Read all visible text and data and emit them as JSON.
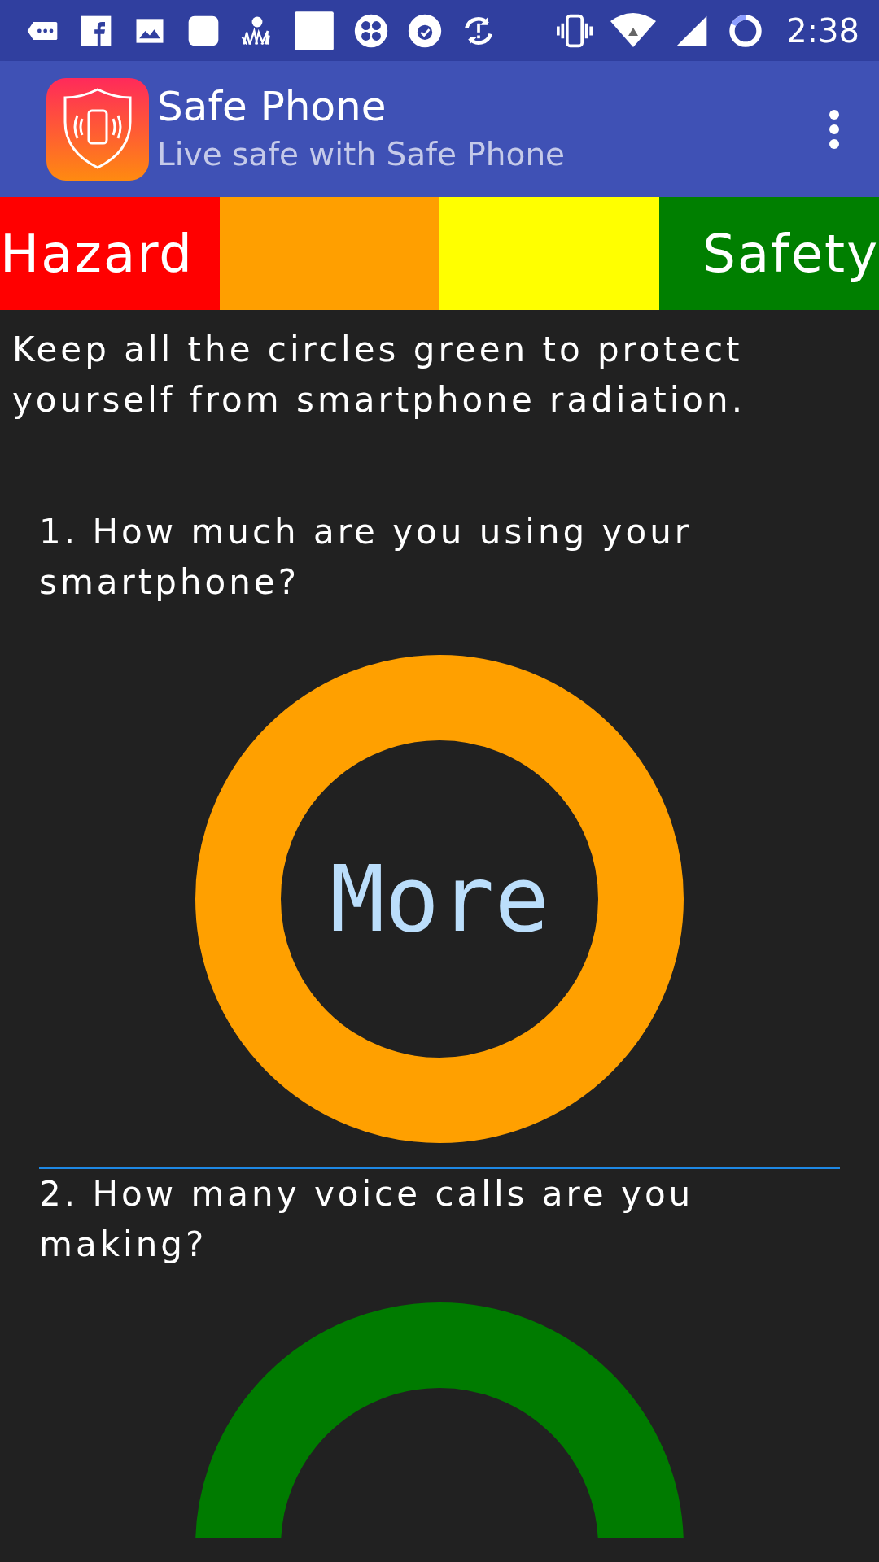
{
  "status_bar": {
    "time": "2:38"
  },
  "app_bar": {
    "title": "Safe Phone",
    "subtitle": "Live safe with Safe Phone"
  },
  "scale": [
    {
      "label": "Hazard",
      "color": "#ff0000"
    },
    {
      "color": "#ff9f00"
    },
    {
      "color": "#ffff00"
    },
    {
      "label": "Safety",
      "color": "#007f00"
    }
  ],
  "intro": "Keep all the circles green to protect yourself from smartphone radiation.",
  "questions": [
    {
      "text": "1. How much are you using your smartphone?",
      "answer": "More",
      "color": "#ffa000",
      "kind": "full"
    },
    {
      "text": "2. How many voice calls are you making?",
      "color": "#007b00",
      "kind": "half"
    }
  ]
}
